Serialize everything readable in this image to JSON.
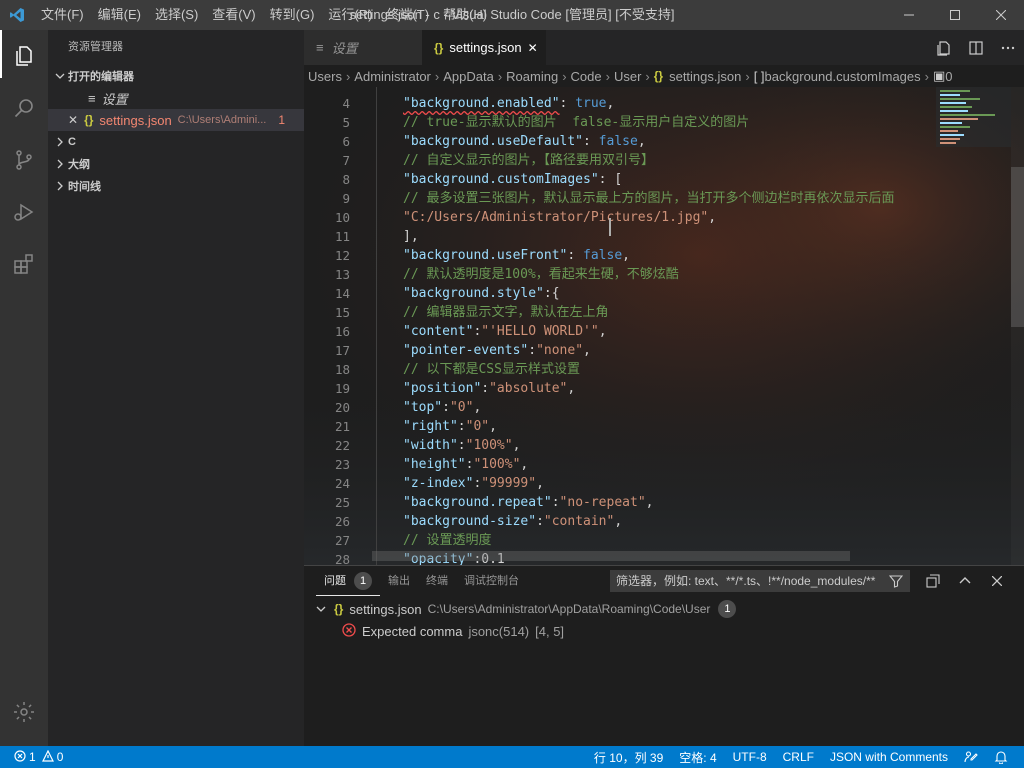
{
  "window": {
    "title": "settings.json - c - Visual Studio Code [管理员] [不受支持]",
    "menu": [
      "文件(F)",
      "编辑(E)",
      "选择(S)",
      "查看(V)",
      "转到(G)",
      "运行(R)",
      "终端(T)",
      "帮助(H)"
    ]
  },
  "sidebar": {
    "title": "资源管理器",
    "open_editors_header": "打开的编辑器",
    "open_items": [
      {
        "label": "设置"
      },
      {
        "label": "settings.json",
        "path": "C:\\Users\\Admini...",
        "count": "1"
      }
    ],
    "sections": [
      "C",
      "大纲",
      "时间线"
    ]
  },
  "tabs": [
    {
      "label": "设置"
    },
    {
      "label": "settings.json"
    }
  ],
  "breadcrumbs": [
    "Users",
    "Administrator",
    "AppData",
    "Roaming",
    "Code",
    "User",
    "settings.json",
    "background.customImages",
    "0"
  ],
  "editor": {
    "lines": [
      {
        "n": "4",
        "tokens": [
          [
            "k",
            "\"background.enabled\""
          ],
          [
            "p",
            ": "
          ],
          [
            "b",
            "true"
          ],
          [
            "p",
            ","
          ]
        ]
      },
      {
        "n": "5",
        "tokens": [
          [
            "c",
            "// true-显示默认的图片  false-显示用户自定义的图片"
          ]
        ]
      },
      {
        "n": "6",
        "tokens": [
          [
            "k",
            "\"background.useDefault\""
          ],
          [
            "p",
            ": "
          ],
          [
            "b",
            "false"
          ],
          [
            "p",
            ","
          ]
        ]
      },
      {
        "n": "7",
        "tokens": [
          [
            "c",
            "// 自定义显示的图片，【路径要用双引号】"
          ]
        ]
      },
      {
        "n": "8",
        "tokens": [
          [
            "k",
            "\"background.customImages\""
          ],
          [
            "p",
            ": ["
          ]
        ]
      },
      {
        "n": "9",
        "tokens": [
          [
            "c",
            "// 最多设置三张图片，默认显示最上方的图片，当打开多个侧边栏时再依次显示后面"
          ]
        ]
      },
      {
        "n": "10",
        "tokens": [
          [
            "s",
            "\"C:/Users/Administrator/Pictures/1.jpg\""
          ],
          [
            "p",
            ","
          ]
        ]
      },
      {
        "n": "11",
        "tokens": [
          [
            "p",
            "],"
          ]
        ]
      },
      {
        "n": "12",
        "tokens": [
          [
            "k",
            "\"background.useFront\""
          ],
          [
            "p",
            ": "
          ],
          [
            "b",
            "false"
          ],
          [
            "p",
            ","
          ]
        ]
      },
      {
        "n": "13",
        "tokens": [
          [
            "c",
            "// 默认透明度是100%，看起来生硬，不够炫酷"
          ]
        ]
      },
      {
        "n": "14",
        "tokens": [
          [
            "k",
            "\"background.style\""
          ],
          [
            "p",
            ":{"
          ]
        ]
      },
      {
        "n": "15",
        "tokens": [
          [
            "c",
            "// 编辑器显示文字，默认在左上角"
          ]
        ]
      },
      {
        "n": "16",
        "tokens": [
          [
            "k",
            "\"content\""
          ],
          [
            "p",
            ":"
          ],
          [
            "s",
            "\"'HELLO WORLD'\""
          ],
          [
            "p",
            ","
          ]
        ]
      },
      {
        "n": "17",
        "tokens": [
          [
            "k",
            "\"pointer-events\""
          ],
          [
            "p",
            ":"
          ],
          [
            "s",
            "\"none\""
          ],
          [
            "p",
            ","
          ]
        ]
      },
      {
        "n": "18",
        "tokens": [
          [
            "c",
            "// 以下都是CSS显示样式设置"
          ]
        ]
      },
      {
        "n": "19",
        "tokens": [
          [
            "k",
            "\"position\""
          ],
          [
            "p",
            ":"
          ],
          [
            "s",
            "\"absolute\""
          ],
          [
            "p",
            ","
          ]
        ]
      },
      {
        "n": "20",
        "tokens": [
          [
            "k",
            "\"top\""
          ],
          [
            "p",
            ":"
          ],
          [
            "s",
            "\"0\""
          ],
          [
            "p",
            ","
          ]
        ]
      },
      {
        "n": "21",
        "tokens": [
          [
            "k",
            "\"right\""
          ],
          [
            "p",
            ":"
          ],
          [
            "s",
            "\"0\""
          ],
          [
            "p",
            ","
          ]
        ]
      },
      {
        "n": "22",
        "tokens": [
          [
            "k",
            "\"width\""
          ],
          [
            "p",
            ":"
          ],
          [
            "s",
            "\"100%\""
          ],
          [
            "p",
            ","
          ]
        ]
      },
      {
        "n": "23",
        "tokens": [
          [
            "k",
            "\"height\""
          ],
          [
            "p",
            ":"
          ],
          [
            "s",
            "\"100%\""
          ],
          [
            "p",
            ","
          ]
        ]
      },
      {
        "n": "24",
        "tokens": [
          [
            "k",
            "\"z-index\""
          ],
          [
            "p",
            ":"
          ],
          [
            "s",
            "\"99999\""
          ],
          [
            "p",
            ","
          ]
        ]
      },
      {
        "n": "25",
        "tokens": [
          [
            "k",
            "\"background.repeat\""
          ],
          [
            "p",
            ":"
          ],
          [
            "s",
            "\"no-repeat\""
          ],
          [
            "p",
            ","
          ]
        ]
      },
      {
        "n": "26",
        "tokens": [
          [
            "k",
            "\"background-size\""
          ],
          [
            "p",
            ":"
          ],
          [
            "s",
            "\"contain\""
          ],
          [
            "p",
            ","
          ]
        ]
      },
      {
        "n": "27",
        "tokens": [
          [
            "c",
            "// 设置透明度"
          ]
        ]
      },
      {
        "n": "28",
        "tokens": [
          [
            "k",
            "\"opacity\""
          ],
          [
            "p",
            ":0.1"
          ]
        ]
      }
    ]
  },
  "panel": {
    "tabs": [
      {
        "label": "问题",
        "badge": "1"
      },
      {
        "label": "输出"
      },
      {
        "label": "终端"
      },
      {
        "label": "调试控制台"
      }
    ],
    "filter_placeholder": "筛选器，例如: text、**/*.ts、!**/node_modules/**",
    "problem_file": {
      "name": "settings.json",
      "path": "C:\\Users\\Administrator\\AppData\\Roaming\\Code\\User",
      "count": "1"
    },
    "problem": {
      "message": "Expected comma",
      "source": "jsonc(514)",
      "position": "[4, 5]"
    }
  },
  "status": {
    "errors": "1",
    "warnings": "0",
    "position": "行 10，列 39",
    "spaces": "空格: 4",
    "encoding": "UTF-8",
    "eol": "CRLF",
    "language": "JSON with Comments"
  },
  "colors": {
    "statusbar": "#007acc",
    "error": "#f14c4c"
  }
}
